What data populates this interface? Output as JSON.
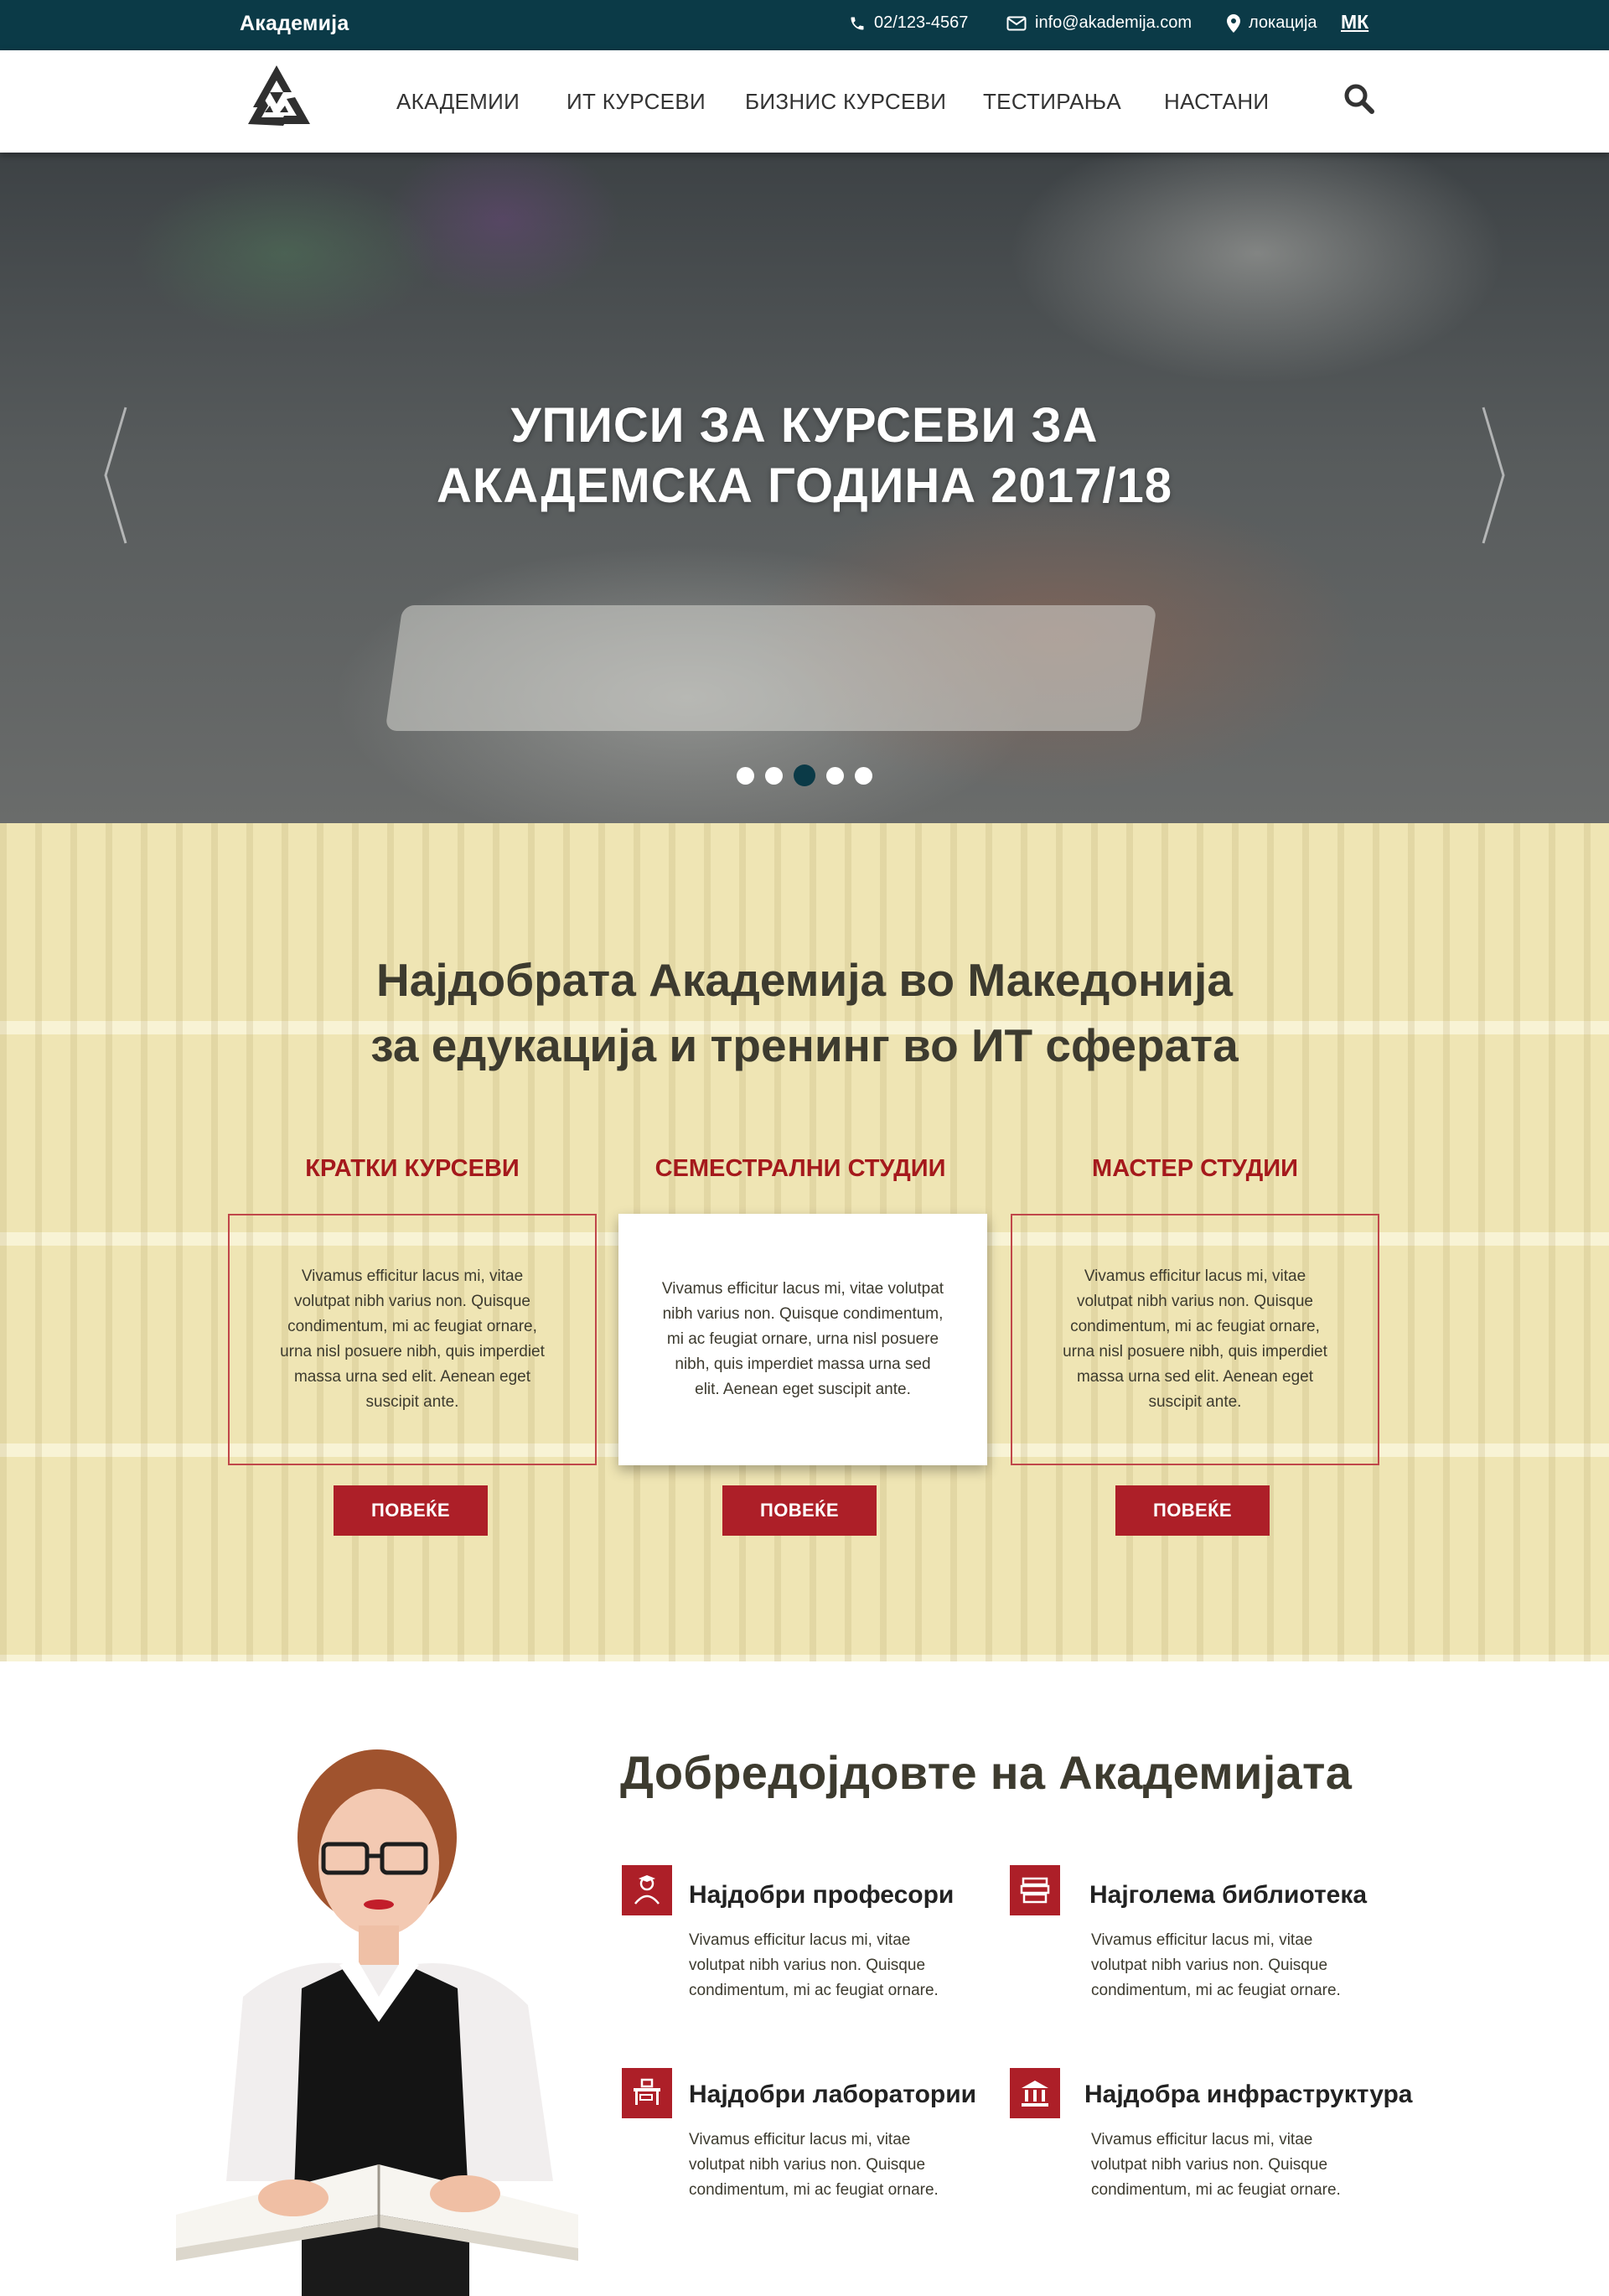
{
  "topbar": {
    "brand": "Академија",
    "phone": "02/123-4567",
    "email": "info@akademija.com",
    "location": "локација",
    "language": "МК"
  },
  "nav": {
    "items": [
      "АКАДЕМИИ",
      "ИТ КУРСЕВИ",
      "БИЗНИС КУРСЕВИ",
      "ТЕСТИРАЊА",
      "НАСТАНИ"
    ]
  },
  "hero": {
    "title_line1": "УПИСИ ЗА КУРСЕВИ ЗА",
    "title_line2": "АКАДЕМСКА ГОДИНА 2017/18",
    "slides_count": 5,
    "active_slide": 3
  },
  "academy": {
    "heading_line1": "Најдобрата Академија во Македонија",
    "heading_line2": "за едукација и тренинг во ИТ сферата",
    "columns": [
      {
        "title": "КРАТКИ КУРСЕВИ",
        "text": "Vivamus efficitur lacus mi, vitae volutpat nibh varius non. Quisque condimentum, mi ac feugiat ornare, urna nisl posuere nibh, quis imperdiet massa urna sed elit. Aenean eget suscipit ante.",
        "button": "ПОВЕЌЕ"
      },
      {
        "title": "СЕМЕСТРАЛНИ СТУДИИ",
        "text": "Vivamus efficitur lacus mi, vitae volutpat nibh varius non. Quisque condimentum, mi ac feugiat ornare, urna nisl posuere nibh, quis imperdiet massa urna sed elit. Aenean eget suscipit ante.",
        "button": "ПОВЕЌЕ"
      },
      {
        "title": "МАСТЕР СТУДИИ",
        "text": "Vivamus efficitur lacus mi, vitae volutpat nibh varius non. Quisque condimentum, mi ac feugiat ornare, urna nisl posuere nibh, quis imperdiet massa urna sed elit. Aenean eget suscipit ante.",
        "button": "ПОВЕЌЕ"
      }
    ]
  },
  "welcome": {
    "title": "Добредојдовте на Академијата",
    "features": [
      {
        "icon": "professor-icon",
        "title": "Најдобри професори",
        "text": "Vivamus efficitur lacus mi, vitae volutpat nibh varius non. Quisque condimentum, mi ac feugiat ornare."
      },
      {
        "icon": "books-icon",
        "title": "Најголема библиотека",
        "text": "Vivamus efficitur lacus mi, vitae volutpat nibh varius non. Quisque condimentum, mi ac feugiat ornare."
      },
      {
        "icon": "lab-desk-icon",
        "title": "Најдобри лаборатории",
        "text": "Vivamus efficitur lacus mi, vitae volutpat nibh varius non. Quisque condimentum, mi ac feugiat ornare."
      },
      {
        "icon": "building-icon",
        "title": "Најдобра инфраструктура",
        "text": "Vivamus efficitur lacus mi, vitae volutpat nibh varius non. Quisque condimentum, mi ac feugiat ornare."
      }
    ]
  },
  "colors": {
    "topbar": "#0b3a47",
    "accent_red": "#ad1f28",
    "section_bg": "#efe5b4",
    "heading_text": "#3d3b2f"
  }
}
